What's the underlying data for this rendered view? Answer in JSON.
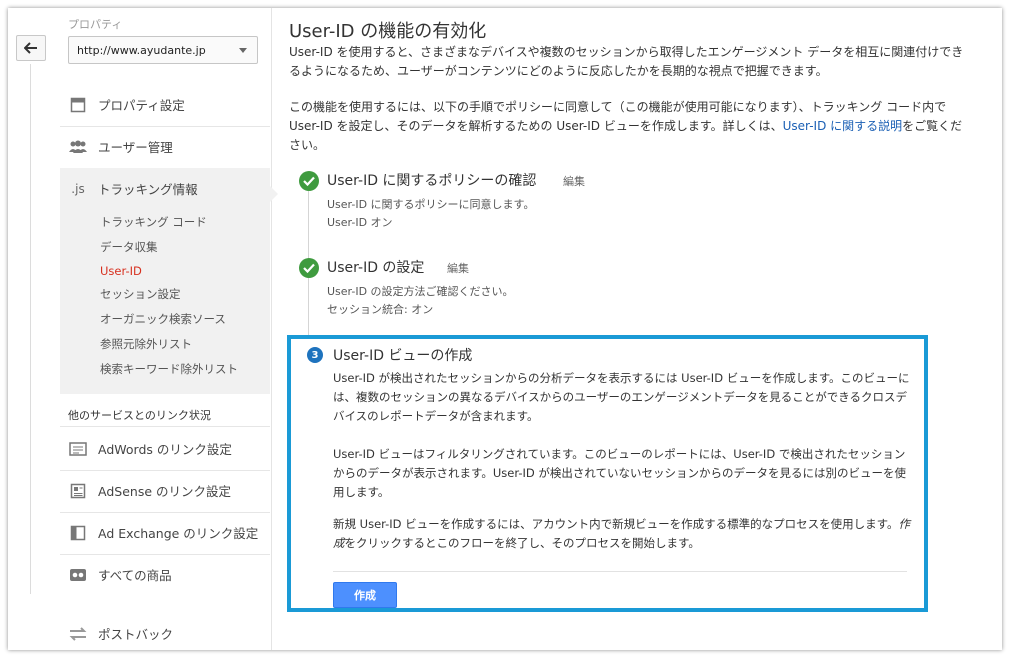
{
  "sidebar": {
    "property_label": "プロパティ",
    "property_value": "http://www.ayudante.jp",
    "items": [
      {
        "label": "プロパティ設定",
        "icon": "square-icon"
      },
      {
        "label": "ユーザー管理",
        "icon": "users-icon"
      },
      {
        "label": "トラッキング情報",
        "icon": "js-icon",
        "icon_text": ".js"
      }
    ],
    "tracking_sub": [
      {
        "label": "トラッキング コード"
      },
      {
        "label": "データ収集"
      },
      {
        "label": "User-ID"
      },
      {
        "label": "セッション設定"
      },
      {
        "label": "オーガニック検索ソース"
      },
      {
        "label": "参照元除外リスト"
      },
      {
        "label": "検索キーワード除外リスト"
      }
    ],
    "links_section_title": "他のサービスとのリンク状況",
    "link_items": [
      {
        "label": "AdWords のリンク設定",
        "icon": "adwords-icon"
      },
      {
        "label": "AdSense のリンク設定",
        "icon": "adsense-icon"
      },
      {
        "label": "Ad Exchange のリンク設定",
        "icon": "adexchange-icon"
      },
      {
        "label": "すべての商品",
        "icon": "products-icon"
      },
      {
        "label": "ポストバック",
        "icon": "postback-icon"
      }
    ]
  },
  "main": {
    "title": "User-ID の機能の有効化",
    "intro1": "User-ID を使用すると、さまざまなデバイスや複数のセッションから取得したエンゲージメント データを相互に関連付けできるようになるため、ユーザーがコンテンツにどのように反応したかを長期的な視点で把握できます。",
    "intro2_pre": "この機能を使用するには、以下の手順でポリシーに同意して（この機能が使用可能になります）、トラッキング コード内で User-ID を設定し、そのデータを解析するための User-ID ビューを作成します。詳しくは、",
    "intro2_link": "User-ID に関する説明",
    "intro2_post": "をご覧ください。",
    "steps": [
      {
        "title": "User-ID に関するポリシーの確認",
        "edit": "編集",
        "lines": [
          "User-ID に関するポリシーに同意します。",
          "User-ID オン"
        ]
      },
      {
        "title": "User-ID の設定",
        "edit": "編集",
        "lines": [
          "User-ID の設定方法ご確認ください。",
          "セッション統合: オン"
        ]
      }
    ],
    "step3": {
      "number": "3",
      "title": "User-ID ビューの作成",
      "para1": "User-ID が検出されたセッションからの分析データを表示するには User-ID ビューを作成します。このビューには、複数のセッションの異なるデバイスからのユーザーのエンゲージメントデータを見ることができるクロスデバイスのレポートデータが含まれます。",
      "para2": "User-ID ビューはフィルタリングされています。このビューのレポートには、User-ID で検出されたセッションからのデータが表示されます。User-ID が検出されていないセッションからのデータを見るには別のビューを使用します。",
      "para3_pre": "新規 User-ID ビューを作成するには、アカウント内で新規ビューを作成する標準的なプロセスを使用します。",
      "para3_em": "作成",
      "para3_post": "をクリックするとこのフローを終了し、そのプロセスを開始します。",
      "button": "作成"
    }
  },
  "colors": {
    "active_nav": "#d7301f",
    "highlight_border": "#1a9ad6",
    "check_green": "#3f9b3f",
    "primary_button": "#4d90fe",
    "link": "#1a5fb4"
  }
}
